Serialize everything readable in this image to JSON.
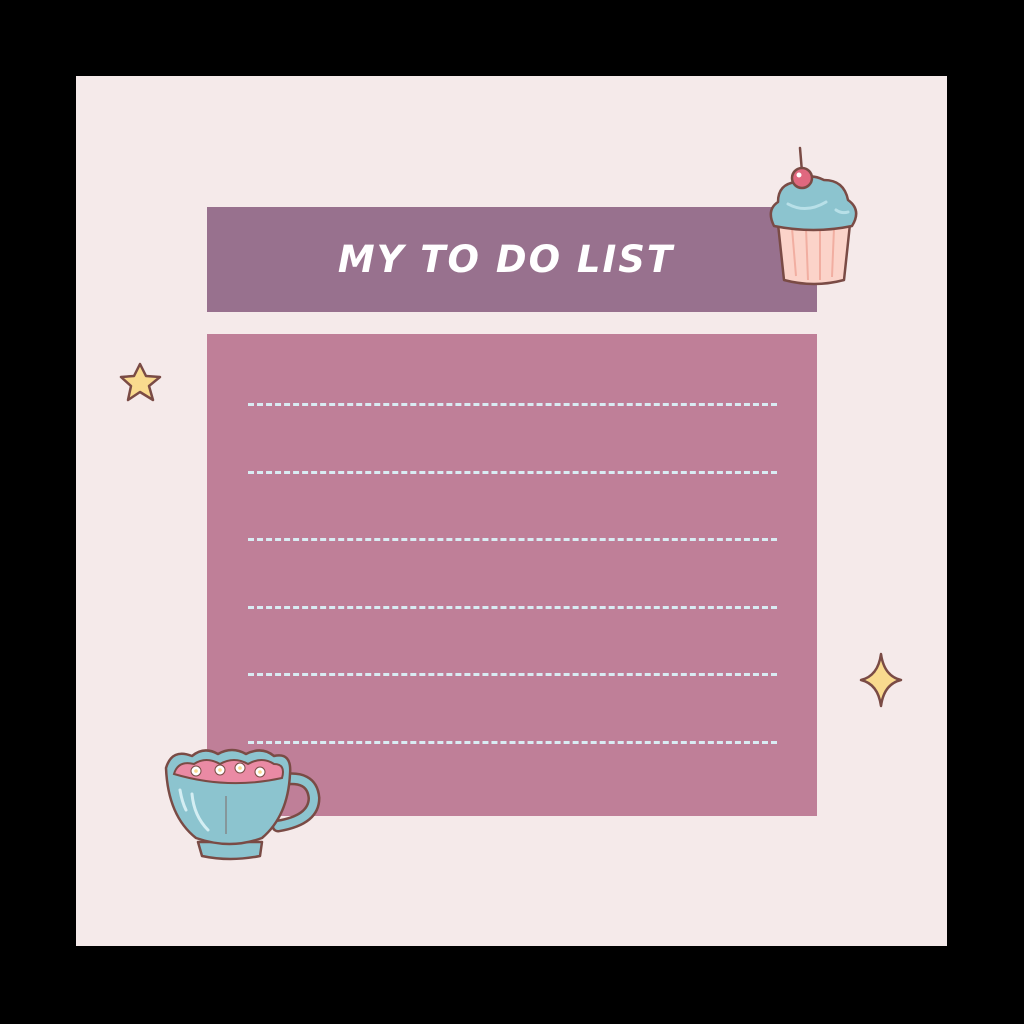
{
  "title": "MY TO DO LIST",
  "lines": [
    "",
    "",
    "",
    "",
    "",
    ""
  ],
  "colors": {
    "background": "#000000",
    "card": "#f5eaea",
    "header": "#98718e",
    "panel": "#bf7f98",
    "line": "#d9ecf3",
    "accent_star": "#f9da8e"
  },
  "icons": [
    "cupcake-icon",
    "star-icon",
    "sparkle-icon",
    "teacup-icon"
  ]
}
